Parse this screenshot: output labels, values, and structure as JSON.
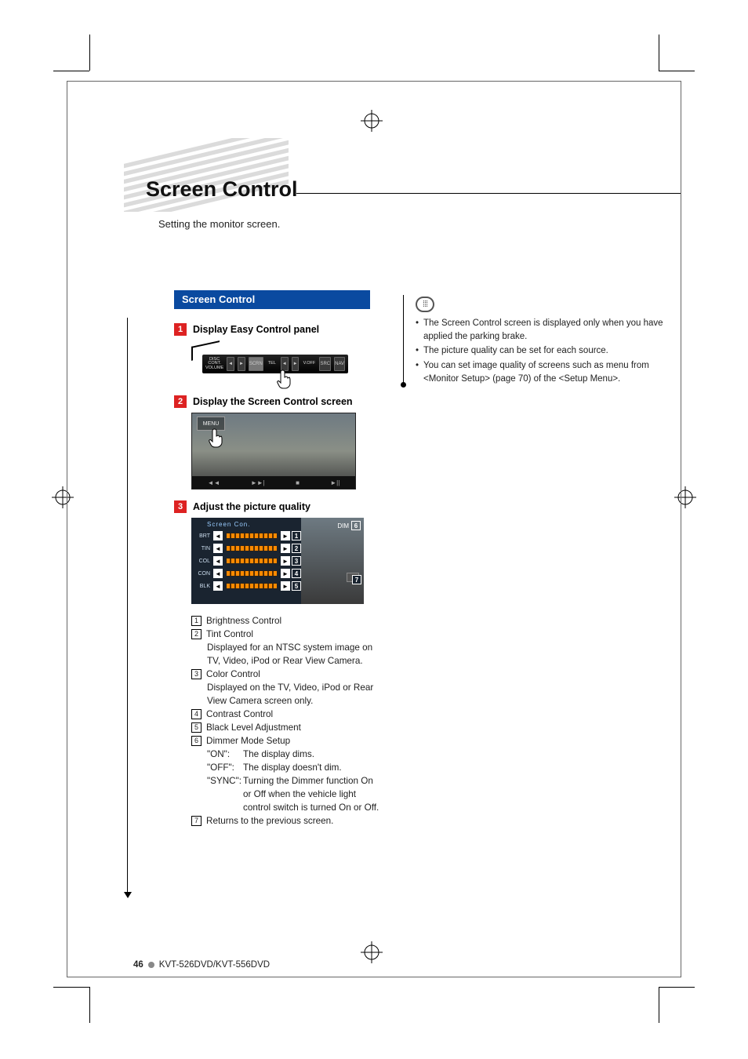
{
  "title": "Screen Control",
  "subtitle": "Setting the monitor screen.",
  "section_heading": "Screen Control",
  "steps": [
    {
      "n": "1",
      "label": "Display Easy Control panel"
    },
    {
      "n": "2",
      "label": "Display the Screen Control screen"
    },
    {
      "n": "3",
      "label": "Adjust the picture quality"
    }
  ],
  "ecp": {
    "left_label_top": "DISC",
    "left_label_mid": "CONT.",
    "left_label_bot": "VOLUME",
    "tel": "TEL",
    "voff": "V.OFF",
    "btn_scrn": "SCRN",
    "btn_src": "SRC",
    "btn_nav": "NAV"
  },
  "scr2": {
    "menu": "MENU",
    "bb": [
      "◄◄",
      "►►|",
      "■",
      "►||"
    ]
  },
  "scr3": {
    "header": "Screen Con.",
    "dim_label": "DIM",
    "dim_callout": "6",
    "ret_callout": "7",
    "rows": [
      {
        "tag": "BRT",
        "left": "◄",
        "right": "►",
        "callout": "1"
      },
      {
        "tag": "TIN",
        "left": "◄",
        "right": "►",
        "callout": "2"
      },
      {
        "tag": "COL",
        "left": "◄",
        "right": "►",
        "callout": "3"
      },
      {
        "tag": "CON",
        "left": "◄",
        "right": "►",
        "callout": "4"
      },
      {
        "tag": "BLK",
        "left": "◄",
        "right": "►",
        "callout": "5"
      }
    ]
  },
  "defs": [
    {
      "n": "1",
      "head": "Brightness Control"
    },
    {
      "n": "2",
      "head": "Tint Control",
      "sub": "Displayed for an NTSC system image on TV, Video, iPod or Rear View Camera."
    },
    {
      "n": "3",
      "head": "Color Control",
      "sub": "Displayed on the TV, Video, iPod or Rear View Camera screen only."
    },
    {
      "n": "4",
      "head": "Contrast Control"
    },
    {
      "n": "5",
      "head": "Black Level Adjustment"
    },
    {
      "n": "6",
      "head": "Dimmer Mode Setup",
      "modes": [
        {
          "k": "\"ON\":",
          "v": "The display dims."
        },
        {
          "k": "\"OFF\":",
          "v": "The display doesn't dim."
        },
        {
          "k": "\"SYNC\":",
          "v": "Turning the Dimmer function On or Off when the vehicle light control switch is turned On or Off."
        }
      ]
    },
    {
      "n": "7",
      "head": "Returns to the previous screen."
    }
  ],
  "notes": [
    "The Screen Control screen is displayed only when you have applied the parking brake.",
    "The picture quality can be set for each source.",
    "You can set image quality of screens such as menu from <Monitor Setup> (page 70) of the <Setup Menu>."
  ],
  "footer": {
    "page": "46",
    "model": "KVT-526DVD/KVT-556DVD"
  }
}
